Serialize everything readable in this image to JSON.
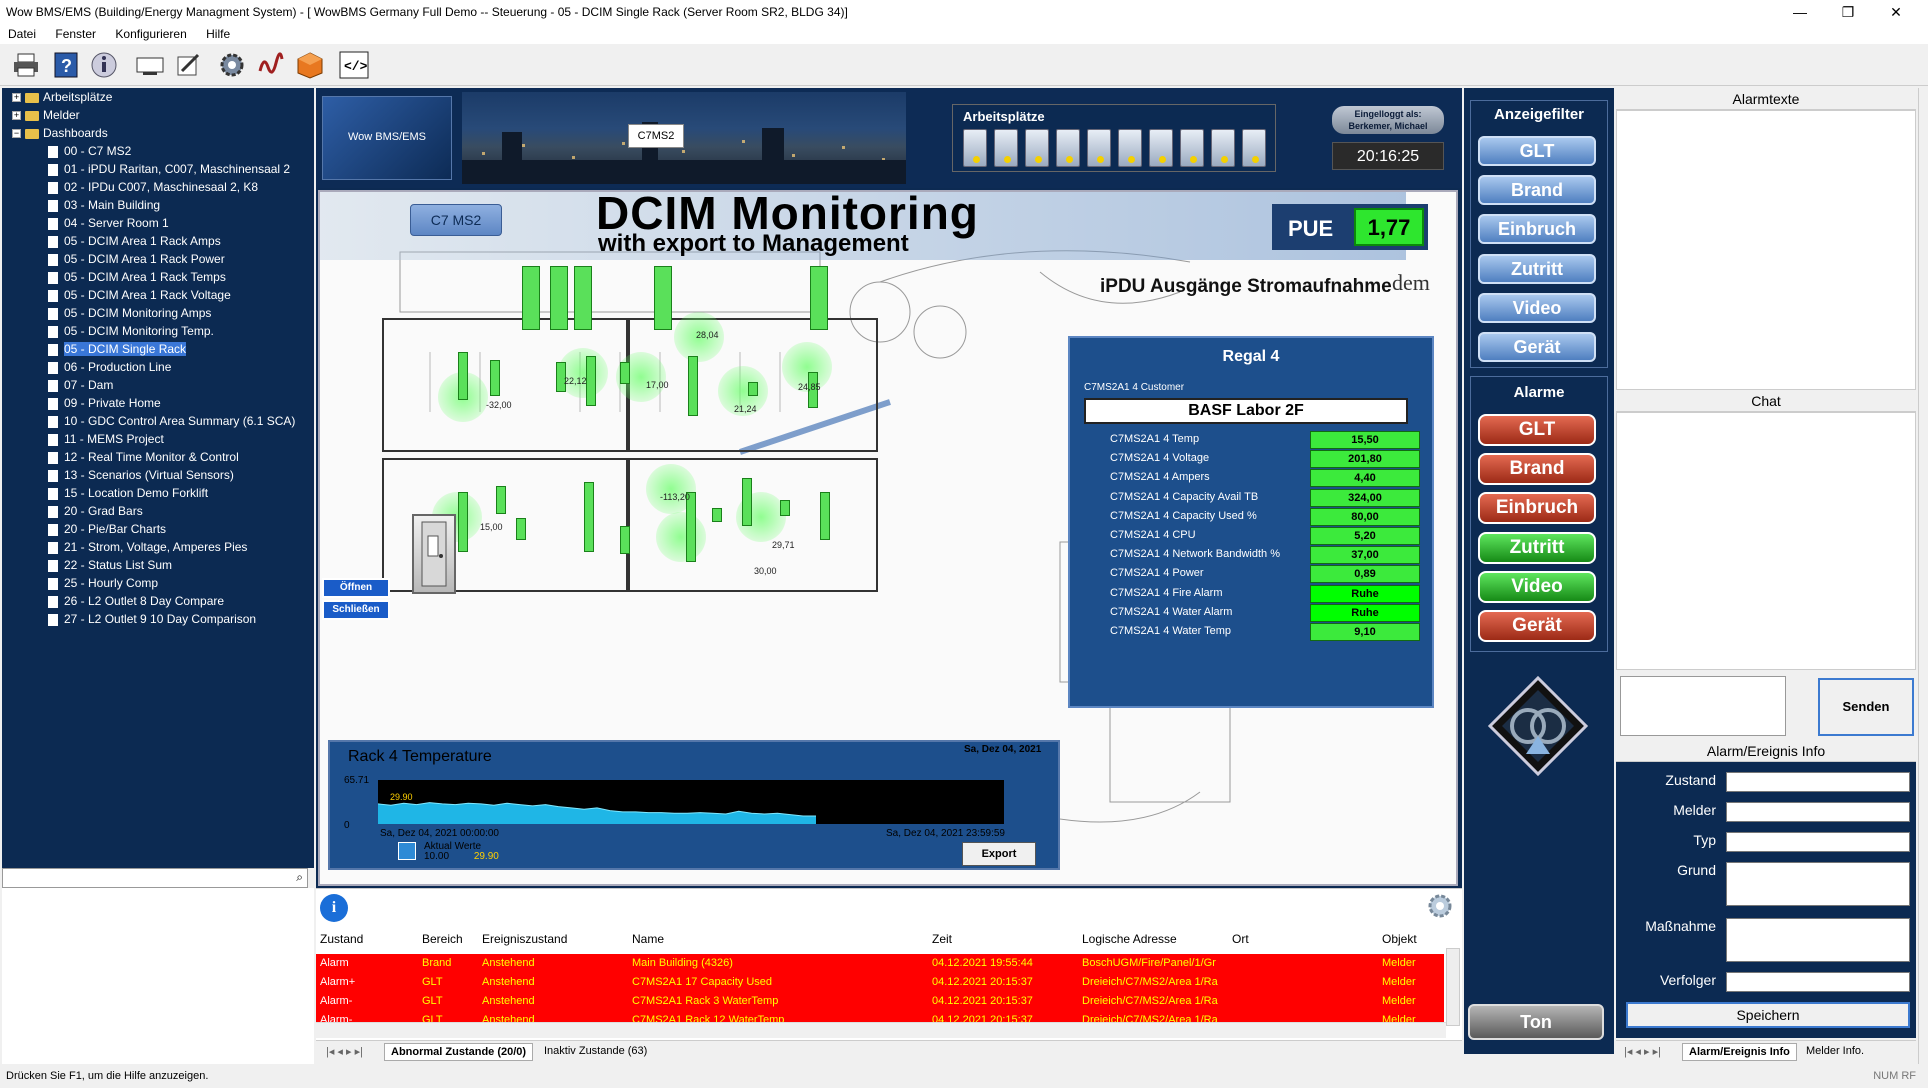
{
  "window": {
    "title": "Wow BMS/EMS (Building/Energy Managment System) - [ WowBMS Germany Full Demo -- Steuerung - 05 - DCIM Single Rack (Server Room SR2, BLDG 34)]",
    "min": "—",
    "max": "❐",
    "close": "✕"
  },
  "menu": [
    "Datei",
    "Fenster",
    "Konfigurieren",
    "Hilfe"
  ],
  "tree": {
    "groups": [
      {
        "label": "Arbeitsplätze",
        "box": "+"
      },
      {
        "label": "Melder",
        "box": "+"
      },
      {
        "label": "Dashboards",
        "box": "−"
      }
    ],
    "items": [
      "00 - C7 MS2",
      "01 - iPDU Raritan, C007, Maschinensaal 2",
      "02 - IPDu C007, Maschinesaal 2, K8",
      "03 - Main Building",
      "04 - Server Room 1",
      "05 - DCIM Area 1 Rack Amps",
      "05 - DCIM Area 1 Rack Power",
      "05 - DCIM Area 1 Rack Temps",
      "05 - DCIM Area 1 Rack Voltage",
      "05 - DCIM Monitoring Amps",
      "05 - DCIM Monitoring Temp.",
      "05 - DCIM Single Rack",
      "06 - Production Line",
      "07 - Dam",
      "09 - Private Home",
      "10 - GDC Control Area Summary (6.1 SCA)",
      "11 - MEMS Project",
      "12 - Real Time Monitor & Control",
      "13 - Scenarios (Virtual Sensors)",
      "15 - Location Demo Forklift",
      "20 - Grad Bars",
      "20 - Pie/Bar Charts",
      "21 - Strom, Voltage, Amperes Pies",
      "22 - Status List Sum",
      "25 - Hourly Comp",
      "26 - L2 Outlet 8 Day Compare",
      "27 - L2 Outlet 9 10 Day Comparison"
    ],
    "selected_index": 11
  },
  "status_bar": "Drücken Sie F1, um die Hilfe anzuzeigen.",
  "status_right": "NUM  RF",
  "header": {
    "logo": "Wow BMS/EMS",
    "c7_label": "C7MS2",
    "arbeitsplaetze_label": "Arbeitsplätze",
    "login": "Eingelloggt als:\nBerkemer, Michael",
    "login_line1": "Eingelloggt als:",
    "login_line2": "Berkemer, Michael",
    "clock": "20:16:25"
  },
  "dcim": {
    "title": "DCIM Monitoring",
    "subtitle": "with export to Management",
    "c7_button": "C7 MS2",
    "pue_label": "PUE",
    "pue_value": "1,77",
    "ipdu_title": "iPDU Ausgänge Stromaufnahme",
    "dem": "dem",
    "open_button": "Öffnen",
    "close_button": "Schließen",
    "rack_values": [
      "-32,00",
      "22,12",
      "17,00",
      "28,04",
      "21,24",
      "24,85",
      "15,00",
      "-113,20",
      "30,00",
      "29,71"
    ]
  },
  "regal": {
    "title": "Regal 4",
    "customer_label": "C7MS2A1  4 Customer",
    "customer": "BASF Labor 2F",
    "rows": [
      {
        "label": "C7MS2A1  4 Temp",
        "value": "15,50"
      },
      {
        "label": "C7MS2A1  4 Voltage",
        "value": "201,80"
      },
      {
        "label": "C7MS2A1  4 Ampers",
        "value": "4,40"
      },
      {
        "label": "C7MS2A1  4 Capacity Avail TB",
        "value": "324,00"
      },
      {
        "label": "C7MS2A1  4 Capacity Used %",
        "value": "80,00"
      },
      {
        "label": "C7MS2A1  4 CPU",
        "value": "5,20"
      },
      {
        "label": "C7MS2A1  4 Network Bandwidth %",
        "value": "37,00"
      },
      {
        "label": "C7MS2A1  4 Power",
        "value": "0,89"
      },
      {
        "label": "C7MS2A1  4 Fire Alarm",
        "value": "Ruhe"
      },
      {
        "label": "C7MS2A1  4 Water Alarm",
        "value": "Ruhe"
      },
      {
        "label": "C7MS2A1  4 Water Temp",
        "value": "9,10"
      }
    ]
  },
  "temp_panel": {
    "title": "Rack 4 Temperature",
    "date": "Sa, Dez 04, 2021",
    "ymax": "65.71",
    "yzero": "0",
    "start": "Sa, Dez 04, 2021 00:00:00",
    "end": "Sa, Dez 04, 2021 23:59:59",
    "marker": "29.90",
    "legend_label": "Aktual Werte",
    "legend_v1": "10.00",
    "legend_v2": "29.90",
    "export": "Export"
  },
  "chart_data": {
    "type": "area",
    "title": "Rack 4 Temperature",
    "x_range": [
      "Sa, Dez 04, 2021 00:00:00",
      "Sa, Dez 04, 2021 23:59:59"
    ],
    "ylim": [
      0,
      65.71
    ],
    "series": [
      {
        "name": "Aktual Werte",
        "values": [
          30,
          28,
          31,
          29,
          32,
          30,
          29,
          31,
          30,
          28,
          31,
          29,
          27,
          29,
          26,
          24,
          22,
          24,
          20,
          18,
          18,
          17,
          17,
          16,
          16,
          17,
          16,
          15,
          19,
          16,
          15,
          16,
          14,
          12,
          12
        ]
      }
    ]
  },
  "alarm_table": {
    "headers": [
      "Zustand",
      "Bereich",
      "Ereigniszustand",
      "Name",
      "Zeit",
      "Logische Adresse",
      "Ort",
      "Objekt"
    ],
    "rows": [
      [
        "Alarm",
        "Brand",
        "Anstehend",
        "Main Building (4326)",
        "04.12.2021 19:55:44",
        "BoschUGM/Fire/Panel/1/Gr",
        "",
        "Melder"
      ],
      [
        "Alarm+",
        "GLT",
        "Anstehend",
        "C7MS2A1  17 Capacity Used",
        "04.12.2021 20:15:37",
        "Dreieich/C7/MS2/Area 1/Ra",
        "",
        "Melder"
      ],
      [
        "Alarm-",
        "GLT",
        "Anstehend",
        "C7MS2A1 Rack 3 WaterTemp",
        "04.12.2021 20:15:37",
        "Dreieich/C7/MS2/Area 1/Ra",
        "",
        "Melder"
      ],
      [
        "Alarm-",
        "GLT",
        "Anstehend",
        "C7MS2A1 Rack 12 WaterTemp",
        "04.12.2021 20:15:37",
        "Dreieich/C7/MS2/Area 1/Ra",
        "",
        "Melder"
      ]
    ],
    "tabs": [
      "Abnormal Zustande (20/0)",
      "Inaktiv Zustande (63)"
    ]
  },
  "right_panel": {
    "filter_title": "Anzeigefilter",
    "filters": [
      "GLT",
      "Brand",
      "Einbruch",
      "Zutritt",
      "Video",
      "Gerät"
    ],
    "alarme_title": "Alarme",
    "alarms": [
      {
        "label": "GLT",
        "color": "red"
      },
      {
        "label": "Brand",
        "color": "red"
      },
      {
        "label": "Einbruch",
        "color": "red"
      },
      {
        "label": "Zutritt",
        "color": "green"
      },
      {
        "label": "Video",
        "color": "green"
      },
      {
        "label": "Gerät",
        "color": "red"
      }
    ],
    "ton": "Ton"
  },
  "far_right": {
    "alarmtexte": "Alarmtexte",
    "chat": "Chat",
    "send": "Senden",
    "event_title": "Alarm/Ereignis Info",
    "fields": [
      "Zustand",
      "Melder",
      "Typ",
      "Grund",
      "Maßnahme",
      "Verfolger"
    ],
    "save": "Speichern",
    "tabs": [
      "Alarm/Ereignis Info",
      "Melder Info."
    ]
  }
}
